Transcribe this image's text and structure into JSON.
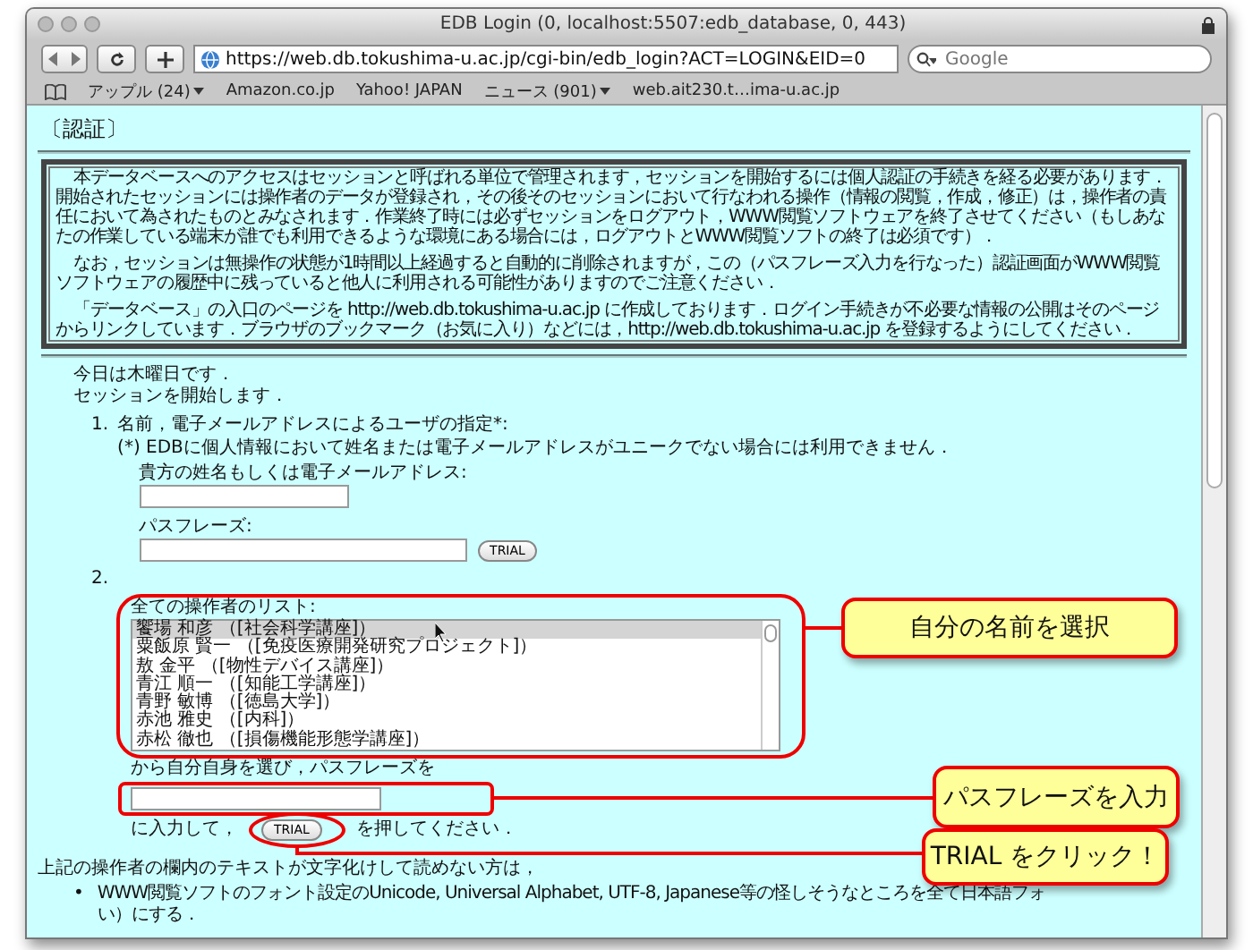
{
  "window": {
    "title": "EDB Login (0, localhost:5507:edb_database, 0, 443)"
  },
  "toolbar": {
    "url": "https://web.db.tokushima-u.ac.jp/cgi-bin/edb_login?ACT=LOGIN&EID=0",
    "search": {
      "placeholder": "Google"
    }
  },
  "bookmarks": [
    {
      "label": "アップル (24)",
      "menu": true
    },
    {
      "label": "Amazon.co.jp",
      "menu": false
    },
    {
      "label": "Yahoo! JAPAN",
      "menu": false
    },
    {
      "label": "ニュース (901)",
      "menu": true
    },
    {
      "label": "web.ait230.t…ima-u.ac.jp",
      "menu": false
    }
  ],
  "page": {
    "heading": "〔認証〕",
    "notice": [
      "本データベースへのアクセスはセッションと呼ばれる単位で管理されます，セッションを開始するには個人認証の手続きを経る必要があります．開始されたセッションには操作者のデータが登録され，その後そのセッションにおいて行なわれる操作（情報の閲覧，作成，修正）は，操作者の責任において為されたものとみなされます．作業終了時には必ずセッションをログアウト，WWW閲覧ソフトウェアを終了させてください（もしあなたの作業している端末が誰でも利用できるような環境にある場合には，ログアウトとWWW閲覧ソフトの終了は必須です）．",
      "なお，セッションは無操作の状態が1時間以上経過すると自動的に削除されますが，この（パスフレーズ入力を行なった）認証画面がWWW閲覧ソフトウェアの履歴中に残っていると他人に利用される可能性がありますのでご注意ください．",
      "「データベース」の入口のページを http://web.db.tokushima-u.ac.jp に作成しております．ログイン手続きが不必要な情報の公開はそのページからリンクしています．ブラウザのブックマーク（お気に入り）などには，http://web.db.tokushima-u.ac.jp を登録するようにしてください．"
    ],
    "greeting": [
      "今日は木曜日です．",
      "セッションを開始します．"
    ],
    "step1": {
      "number": "1.",
      "title": "名前，電子メールアドレスによるユーザの指定*:",
      "note": "(*) EDBに個人情報において姓名または電子メールアドレスがユニークでない場合には利用できません．",
      "name_label": "貴方の姓名もしくは電子メールアドレス:",
      "passphrase_label": "パスフレーズ:",
      "button": "TRIAL"
    },
    "step2": {
      "number": "2.",
      "list_label": "全ての操作者のリスト:",
      "operators": [
        {
          "name": "饗場 和彦 （[社会科学講座]）",
          "selected": true
        },
        {
          "name": "粟飯原 賢一 （[免疫医療開発研究プロジェクト]）",
          "selected": false
        },
        {
          "name": "敖 金平 （[物性デバイス講座]）",
          "selected": false
        },
        {
          "name": "青江 順一 （[知能工学講座]）",
          "selected": false
        },
        {
          "name": "青野 敏博 （[徳島大学]）",
          "selected": false
        },
        {
          "name": "赤池 雅史 （[内科]）",
          "selected": false
        },
        {
          "name": "赤松 徹也 （[損傷機能形態学講座]）",
          "selected": false
        }
      ],
      "instruction_before": "から自分自身を選び，パスフレーズを",
      "instruction_after_1": "に入力して，",
      "button": "TRIAL",
      "instruction_after_2": "を押してください．"
    },
    "help": {
      "intro": "上記の操作者の欄内のテキストが文字化けして読めない方は，",
      "bullets": [
        {
          "marker": "•",
          "lines": [
            "WWW閲覧ソフトのフォント設定のUnicode, Universal Alphabet, UTF-8, Japanese等の怪しそうなところを全て日本語フォ",
            "い）にする．"
          ]
        }
      ]
    }
  },
  "annotations": [
    {
      "text": "自分の名前を選択"
    },
    {
      "text": "パスフレーズを入力"
    },
    {
      "text": "TRIAL をクリック！"
    }
  ]
}
